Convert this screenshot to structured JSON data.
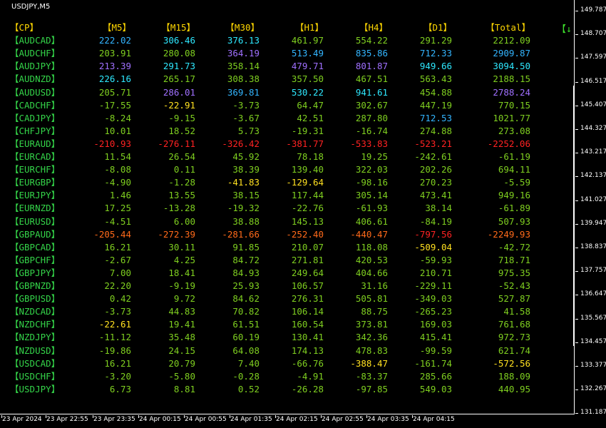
{
  "window_title": "USDJPY,M5",
  "headers": [
    "【CP】",
    "【M5】",
    "【M15】",
    "【M30】",
    "【H1】",
    "【H4】",
    "【D1】",
    "【Total】"
  ],
  "sort_arrow": "【↓",
  "colors": {
    "lime": "#3ed43a",
    "green": "#7fcf20",
    "sky": "#33b5ff",
    "cyan": "#2ee8ff",
    "violet": "#a070ff",
    "red": "#ff2222",
    "orange": "#ff6a1a",
    "yellow": "#ffe020",
    "header": "#ffd700"
  },
  "rows": [
    {
      "pair": "【AUDCAD】",
      "vals": [
        "222.02",
        "306.46",
        "376.13",
        "461.97",
        "554.22",
        "291.29",
        "2212.09"
      ],
      "c": [
        "sky",
        "cyan",
        "cyan",
        "green",
        "green",
        "green",
        "green"
      ]
    },
    {
      "pair": "【AUDCHF】",
      "vals": [
        "203.91",
        "280.08",
        "364.19",
        "513.49",
        "835.86",
        "712.33",
        "2909.87"
      ],
      "c": [
        "green",
        "green",
        "violet",
        "sky",
        "sky",
        "sky",
        "sky"
      ]
    },
    {
      "pair": "【AUDJPY】",
      "vals": [
        "213.39",
        "291.73",
        "358.14",
        "479.71",
        "801.87",
        "949.66",
        "3094.50"
      ],
      "c": [
        "violet",
        "cyan",
        "green",
        "violet",
        "violet",
        "cyan",
        "cyan"
      ]
    },
    {
      "pair": "【AUDNZD】",
      "vals": [
        "226.16",
        "265.17",
        "308.38",
        "357.50",
        "467.51",
        "563.43",
        "2188.15"
      ],
      "c": [
        "cyan",
        "green",
        "green",
        "green",
        "green",
        "green",
        "green"
      ]
    },
    {
      "pair": "【AUDUSD】",
      "vals": [
        "205.71",
        "286.01",
        "369.81",
        "530.22",
        "941.61",
        "454.88",
        "2788.24"
      ],
      "c": [
        "green",
        "violet",
        "sky",
        "cyan",
        "cyan",
        "green",
        "violet"
      ]
    },
    {
      "pair": "【CADCHF】",
      "vals": [
        "-17.55",
        "-22.91",
        "-3.73",
        "64.47",
        "302.67",
        "447.19",
        "770.15"
      ],
      "c": [
        "green",
        "yellow",
        "green",
        "green",
        "green",
        "green",
        "green"
      ]
    },
    {
      "pair": "【CADJPY】",
      "vals": [
        "-8.24",
        "-9.15",
        "-3.67",
        "42.51",
        "287.80",
        "712.53",
        "1021.77"
      ],
      "c": [
        "green",
        "green",
        "green",
        "green",
        "green",
        "sky",
        "green"
      ]
    },
    {
      "pair": "【CHFJPY】",
      "vals": [
        "10.01",
        "18.52",
        "5.73",
        "-19.31",
        "-16.74",
        "274.88",
        "273.08"
      ],
      "c": [
        "green",
        "green",
        "green",
        "green",
        "green",
        "green",
        "green"
      ]
    },
    {
      "pair": "【EURAUD】",
      "vals": [
        "-210.93",
        "-276.11",
        "-326.42",
        "-381.77",
        "-533.83",
        "-523.21",
        "-2252.06"
      ],
      "c": [
        "red",
        "red",
        "red",
        "red",
        "red",
        "red",
        "red"
      ]
    },
    {
      "pair": "【EURCAD】",
      "vals": [
        "11.54",
        "26.54",
        "45.92",
        "78.18",
        "19.25",
        "-242.61",
        "-61.19"
      ],
      "c": [
        "green",
        "green",
        "green",
        "green",
        "green",
        "green",
        "green"
      ]
    },
    {
      "pair": "【EURCHF】",
      "vals": [
        "-8.08",
        "0.11",
        "38.39",
        "139.40",
        "322.03",
        "202.26",
        "694.11"
      ],
      "c": [
        "green",
        "green",
        "green",
        "green",
        "green",
        "green",
        "green"
      ]
    },
    {
      "pair": "【EURGBP】",
      "vals": [
        "-4.90",
        "-1.28",
        "-41.83",
        "-129.64",
        "-98.16",
        "270.23",
        "-5.59"
      ],
      "c": [
        "green",
        "green",
        "yellow",
        "yellow",
        "green",
        "green",
        "green"
      ]
    },
    {
      "pair": "【EURJPY】",
      "vals": [
        "1.46",
        "13.55",
        "38.15",
        "117.44",
        "305.14",
        "473.41",
        "949.16"
      ],
      "c": [
        "green",
        "green",
        "green",
        "green",
        "green",
        "green",
        "green"
      ]
    },
    {
      "pair": "【EURNZD】",
      "vals": [
        "17.25",
        "-13.28",
        "-19.32",
        "-22.76",
        "-61.93",
        "38.14",
        "-61.89"
      ],
      "c": [
        "green",
        "green",
        "green",
        "green",
        "green",
        "green",
        "green"
      ]
    },
    {
      "pair": "【EURUSD】",
      "vals": [
        "-4.51",
        "6.00",
        "38.88",
        "145.13",
        "406.61",
        "-84.19",
        "507.93"
      ],
      "c": [
        "green",
        "green",
        "green",
        "green",
        "green",
        "green",
        "green"
      ]
    },
    {
      "pair": "【GBPAUD】",
      "vals": [
        "-205.44",
        "-272.39",
        "-281.66",
        "-252.40",
        "-440.47",
        "-797.56",
        "-2249.93"
      ],
      "c": [
        "orange",
        "orange",
        "orange",
        "orange",
        "orange",
        "red",
        "orange"
      ]
    },
    {
      "pair": "【GBPCAD】",
      "vals": [
        "16.21",
        "30.11",
        "91.85",
        "210.07",
        "118.08",
        "-509.04",
        "-42.72"
      ],
      "c": [
        "green",
        "green",
        "green",
        "green",
        "green",
        "yellow",
        "green"
      ]
    },
    {
      "pair": "【GBPCHF】",
      "vals": [
        "-2.67",
        "4.25",
        "84.72",
        "271.81",
        "420.53",
        "-59.93",
        "718.71"
      ],
      "c": [
        "green",
        "green",
        "green",
        "green",
        "green",
        "green",
        "green"
      ]
    },
    {
      "pair": "【GBPJPY】",
      "vals": [
        "7.00",
        "18.41",
        "84.93",
        "249.64",
        "404.66",
        "210.71",
        "975.35"
      ],
      "c": [
        "green",
        "green",
        "green",
        "green",
        "green",
        "green",
        "green"
      ]
    },
    {
      "pair": "【GBPNZD】",
      "vals": [
        "22.20",
        "-9.19",
        "25.93",
        "106.57",
        "31.16",
        "-229.11",
        "-52.43"
      ],
      "c": [
        "green",
        "green",
        "green",
        "green",
        "green",
        "green",
        "green"
      ]
    },
    {
      "pair": "【GBPUSD】",
      "vals": [
        "0.42",
        "9.72",
        "84.62",
        "276.31",
        "505.81",
        "-349.03",
        "527.87"
      ],
      "c": [
        "green",
        "green",
        "green",
        "green",
        "green",
        "green",
        "green"
      ]
    },
    {
      "pair": "【NZDCAD】",
      "vals": [
        "-3.73",
        "44.83",
        "70.82",
        "106.14",
        "88.75",
        "-265.23",
        "41.58"
      ],
      "c": [
        "green",
        "green",
        "green",
        "green",
        "green",
        "green",
        "green"
      ]
    },
    {
      "pair": "【NZDCHF】",
      "vals": [
        "-22.61",
        "19.41",
        "61.51",
        "160.54",
        "373.81",
        "169.03",
        "761.68"
      ],
      "c": [
        "yellow",
        "green",
        "green",
        "green",
        "green",
        "green",
        "green"
      ]
    },
    {
      "pair": "【NZDJPY】",
      "vals": [
        "-11.12",
        "35.48",
        "60.19",
        "130.41",
        "342.36",
        "415.41",
        "972.73"
      ],
      "c": [
        "green",
        "green",
        "green",
        "green",
        "green",
        "green",
        "green"
      ]
    },
    {
      "pair": "【NZDUSD】",
      "vals": [
        "-19.86",
        "24.15",
        "64.08",
        "174.13",
        "478.83",
        "-99.59",
        "621.74"
      ],
      "c": [
        "green",
        "green",
        "green",
        "green",
        "green",
        "green",
        "green"
      ]
    },
    {
      "pair": "【USDCAD】",
      "vals": [
        "16.21",
        "20.79",
        "7.40",
        "-66.76",
        "-388.47",
        "-161.74",
        "-572.56"
      ],
      "c": [
        "green",
        "green",
        "green",
        "green",
        "yellow",
        "green",
        "yellow"
      ]
    },
    {
      "pair": "【USDCHF】",
      "vals": [
        "-3.20",
        "-5.80",
        "-0.28",
        "-4.91",
        "-83.37",
        "285.66",
        "188.09"
      ],
      "c": [
        "green",
        "green",
        "green",
        "green",
        "green",
        "green",
        "green"
      ]
    },
    {
      "pair": "【USDJPY】",
      "vals": [
        "6.73",
        "8.81",
        "0.52",
        "-26.28",
        "-97.85",
        "549.03",
        "440.95"
      ],
      "c": [
        "green",
        "green",
        "green",
        "green",
        "green",
        "green",
        "green"
      ]
    }
  ],
  "price_scale": [
    "149.787",
    "148.707",
    "147.597",
    "146.517",
    "145.407",
    "144.327",
    "143.217",
    "142.137",
    "141.027",
    "139.947",
    "138.837",
    "137.757",
    "136.647",
    "135.567",
    "134.457",
    "133.377",
    "132.267",
    "131.187"
  ],
  "time_scale": [
    "23 Apr 2024",
    "23 Apr 22:55",
    "23 Apr 23:35",
    "24 Apr 00:15",
    "24 Apr 00:55",
    "24 Apr 01:35",
    "24 Apr 02:15",
    "24 Apr 02:55",
    "24 Apr 03:35",
    "24 Apr 04:15"
  ]
}
